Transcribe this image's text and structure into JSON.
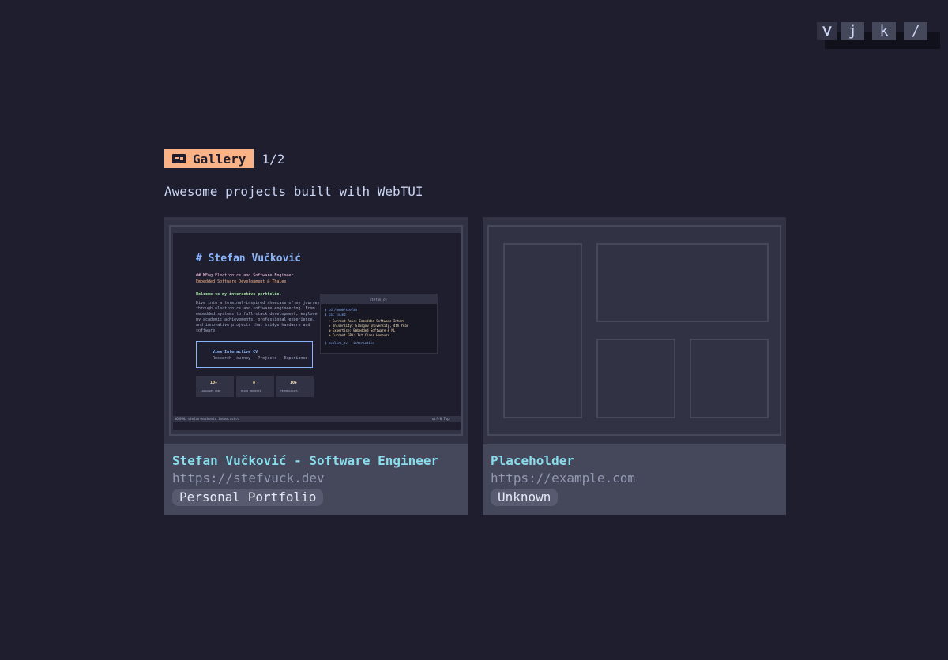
{
  "keys": {
    "logo": "ᐯ",
    "items": [
      "j",
      "k",
      "/"
    ]
  },
  "header": {
    "badge_icon": "card-icon",
    "badge_label": "Gallery",
    "counter": "1/2"
  },
  "subtitle": "Awesome projects built with WebTUI",
  "cards": [
    {
      "title": "Stefan Vučković - Software Engineer",
      "url": "https://stefvuck.dev",
      "tag": "Personal Portfolio",
      "preview": {
        "heading": "# Stefan Vučković",
        "lines": [
          "## MEng Electronics and Software Engineer",
          "Embedded Software Development @ Thales",
          "Welcome to my interactive portfolio.",
          "Dive into a terminal-inspired showcase of my journey",
          "through electronics and software engineering. From",
          "embedded systems to full-stack development, explore",
          "my academic achievements, professional experience,",
          "and innovative projects that bridge hardware and",
          "software."
        ],
        "cv_title": "View Interactive CV",
        "cv_sub": "Research journey · Projects · Experience",
        "stats": [
          {
            "value": "10+",
            "label": "LANGUAGES USED"
          },
          {
            "value": "8",
            "label": "MAJOR PROJECTS"
          },
          {
            "value": "10+",
            "label": "TECHNOLOGIES"
          }
        ],
        "terminal_title": "stefan.cv",
        "terminal_lines": [
          "$ cd /home/stefan",
          "$ cat cv.md",
          "✓ Current Role: Embedded Software Intern",
          "↑ University: Glasgow University, 4th Year",
          "⚙ Expertise: Embedded Software & ML",
          "% Current GPA: 1st Class Honours",
          "$ explore_cv --interactive"
        ],
        "status_left": "NORMAL  stefan-vuckovic  index.astro",
        "status_right": "utf-8  Top"
      }
    },
    {
      "title": "Placeholder",
      "url": "https://example.com",
      "tag": "Unknown"
    }
  ]
}
